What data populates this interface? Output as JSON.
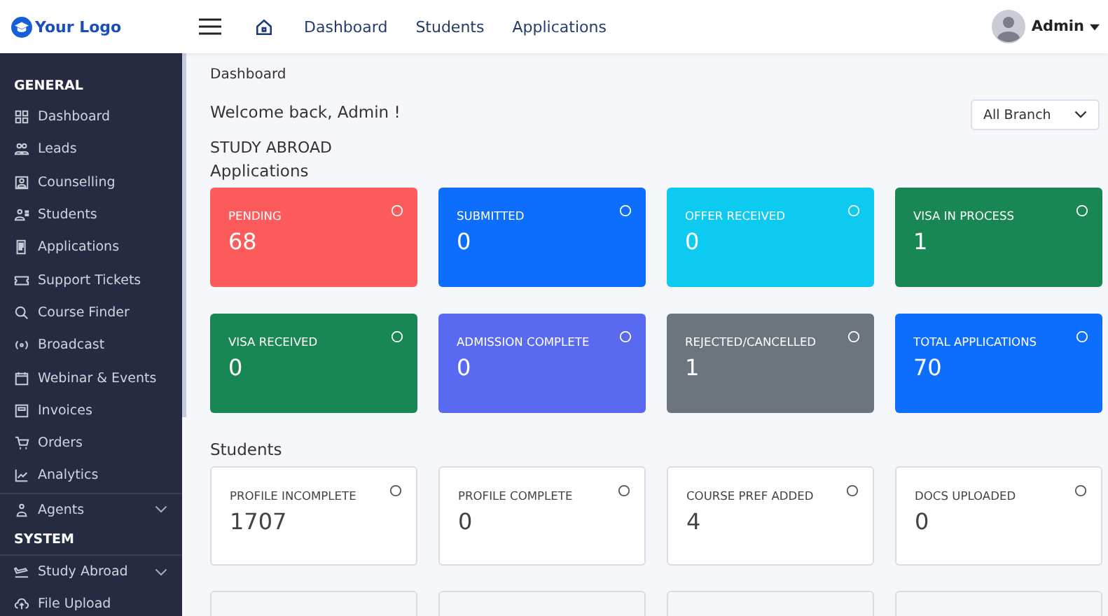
{
  "header": {
    "logo": "Your Logo",
    "nav": [
      "Dashboard",
      "Students",
      "Applications"
    ],
    "user": "Admin"
  },
  "sidebar": {
    "sections": [
      {
        "title": "GENERAL",
        "items": [
          {
            "label": "Dashboard",
            "expandable": false
          },
          {
            "label": "Leads",
            "expandable": false
          },
          {
            "label": "Counselling",
            "expandable": false
          },
          {
            "label": "Students",
            "expandable": false
          },
          {
            "label": "Applications",
            "expandable": false
          },
          {
            "label": "Support Tickets",
            "expandable": false
          },
          {
            "label": "Course Finder",
            "expandable": false
          },
          {
            "label": "Broadcast",
            "expandable": false
          },
          {
            "label": "Webinar & Events",
            "expandable": false
          },
          {
            "label": "Invoices",
            "expandable": false
          },
          {
            "label": "Orders",
            "expandable": false
          },
          {
            "label": "Analytics",
            "expandable": false
          },
          {
            "label": "Agents",
            "expandable": true
          }
        ]
      },
      {
        "title": "SYSTEM",
        "items": [
          {
            "label": "Study Abroad",
            "expandable": true
          },
          {
            "label": "File Upload",
            "expandable": false
          }
        ]
      }
    ]
  },
  "breadcrumb": "Dashboard",
  "welcome": "Welcome back, Admin !",
  "branch_select": {
    "value": "All Branch"
  },
  "section_title": "STUDY ABROAD",
  "applications": {
    "title": "Applications",
    "cards": [
      {
        "label": "PENDING",
        "value": "68",
        "kind": "filled",
        "color": "#fd5b5b"
      },
      {
        "label": "SUBMITTED",
        "value": "0",
        "kind": "filled",
        "color": "#0d6efd"
      },
      {
        "label": "OFFER RECEIVED",
        "value": "0",
        "kind": "filled",
        "color": "#0dcaf0"
      },
      {
        "label": "VISA IN PROCESS",
        "value": "1",
        "kind": "filled",
        "color": "#198754"
      },
      {
        "label": "VISA RECEIVED",
        "value": "0",
        "kind": "filled",
        "color": "#198754"
      },
      {
        "label": "ADMISSION COMPLETE",
        "value": "0",
        "kind": "filled",
        "color": "#5a6af0"
      },
      {
        "label": "REJECTED/CANCELLED",
        "value": "1",
        "kind": "filled",
        "color": "#6c757d"
      },
      {
        "label": "TOTAL APPLICATIONS",
        "value": "70",
        "kind": "filled",
        "color": "#0d6efd"
      }
    ]
  },
  "students": {
    "title": "Students",
    "cards": [
      {
        "label": "PROFILE INCOMPLETE",
        "value": "1707",
        "kind": "outline",
        "color": "#ffffff"
      },
      {
        "label": "PROFILE COMPLETE",
        "value": "0",
        "kind": "outline",
        "color": "#ffffff"
      },
      {
        "label": "COURSE PREF ADDED",
        "value": "4",
        "kind": "outline",
        "color": "#ffffff"
      },
      {
        "label": "DOCS UPLOADED",
        "value": "0",
        "kind": "outline",
        "color": "#ffffff"
      }
    ]
  }
}
